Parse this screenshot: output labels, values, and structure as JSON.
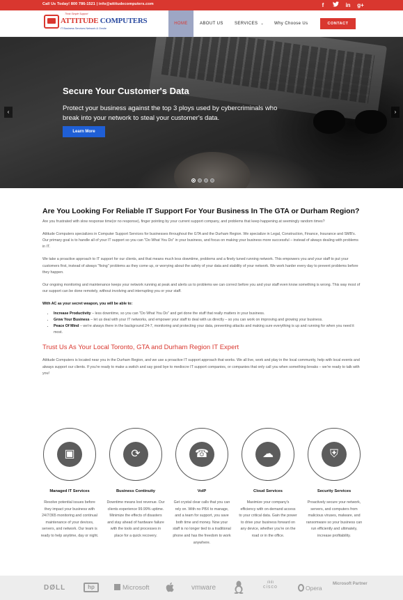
{
  "topbar": {
    "contact_text": "Call Us Today! 800 786-1521 | info@attitudecomputers.com",
    "socials": [
      "f",
      "t",
      "in",
      "g+"
    ],
    "social_icons": [
      "facebook-icon",
      "twitter-icon",
      "linkedin-icon",
      "google-plus-icon"
    ],
    "color": "#d9372f"
  },
  "header": {
    "logo_tagline_top": "Think Simple Support",
    "logo_name_1": "ATTITUDE",
    "logo_name_2": "COMPUTERS",
    "logo_sub": "IT Business Services Network & Onsite",
    "nav": [
      "HOME",
      "ABOUT US",
      "SERVICES",
      "Why Choose Us"
    ],
    "contact_label": "CONTACT"
  },
  "hero": {
    "title": "Secure Your Customer's Data",
    "body": "Protect your business against the top 3 ploys used by cybercriminals who break into your network to steal your customer's data.",
    "button": "Learn More",
    "prev": "‹",
    "next": "›",
    "slides": 4,
    "active_slide": 1
  },
  "intro": {
    "heading": "Are You Looking For Reliable IT Support For Your Business In The GTA or Durham Region?",
    "p1": "Are you frustrated with slow response time(or no response), finger pointing by your current support company, and problems that keep happening at seemingly random times?",
    "p2": "Attitude Computers specializes in Computer Support Services for businesses throughout the GTA and the Durham Region.  We specialize in Legal, Construction, Finance, Insurance and SMB's.  Our primary goal is to handle all of your IT support so you can \"Do What You Do\" in your business, and focus on making your business more successful – instead of always dealing with problems in IT.",
    "p3": "We take a proactive approach to IT support for our clients, and that means much less downtime, problems and a finely tuned running network. This empowers you and your staff to put your customers first, instead of always \"fixing\" problems as they come up, or worrying about the safety of your data and stability of your network. We work harder every day to prevent problems before they happen.",
    "p4": "Our ongoing monitoring and maintenance keeps your network running at peak and alerts us to problems we can correct before you and your staff even know something is wrong. This way most of our support can be done remotely, without involving and interrupting you or your staff.",
    "lead": "With AC as your secret weapon, you will be able to:",
    "bullets": [
      {
        "b": "Increase Productivity",
        "t": " – less downtime, so you can \"Do What You Do\" and get done the stuff that really matters in your business."
      },
      {
        "b": "Grow Your Business",
        "t": " – let us deal with your IT networks, and empower your staff to deal with us directly – so you can work on improving and growing your business."
      },
      {
        "b": "Peace Of Mind",
        "t": " – we're always there in the background 24-7, monitoring and protecting your data, preventing attacks and making sure everything is up and running for when you need it most."
      }
    ],
    "subheading": "Trust Us As Your Local Toronto, GTA and Durham Region IT Expert",
    "p5": "Attitude Computers is located near you in the Durham Region, and we use a proactive IT support approach that works. We all live, work and play in the local community, help with local events and always support our clients. If you're ready to make a switch and say good bye to mediocre IT support companies, or companies that only call you when something breaks – we're ready to talk with you!"
  },
  "services": [
    {
      "icon": "managed-it-icon",
      "glyph": "▣",
      "title": "Managed IT Services",
      "desc": "Resolve potential issues before they impact your business with 24/7/365 monitoring and continual maintenance of your devices, servers, and network. Our team is ready to help anytime, day or night."
    },
    {
      "icon": "business-continuity-icon",
      "glyph": "⟳",
      "title": "Business Continuity",
      "desc": "Downtime means lost revenue. Our clients experience 99.99% uptime. Minimize the effects of disasters and stay ahead of hardware failure with the tools and processes in place for a quick recovery."
    },
    {
      "icon": "voip-phone-icon",
      "glyph": "☎",
      "title": "VoIP",
      "desc": "Get crystal clear calls that you can rely on. With no PBX to manage, and a team for support, you save both time and money. Now your staff is no longer tied to a traditional phone and has the freedom to work anywhere."
    },
    {
      "icon": "cloud-services-icon",
      "glyph": "☁",
      "title": "Cloud Services",
      "desc": "Maximize your company's efficiency with on-demand access to your critical data. Gain the power to drive your business forward on any device, whether you're on the road or in the office."
    },
    {
      "icon": "security-services-icon",
      "glyph": "⛨",
      "title": "Security Services",
      "desc": "Proactively secure your network, servers, and computers from malicious viruses, malware, and ransomware so your business can run efficiently and ultimately, increase profitability."
    }
  ],
  "partners": [
    "DØLL",
    "hp",
    "Microsoft",
    "",
    "vmware",
    "",
    "cisco",
    "Opera",
    "Microsoft Partner"
  ],
  "partner_icons": [
    "dell-logo",
    "hp-logo",
    "microsoft-logo",
    "apple-logo",
    "vmware-logo",
    "linux-tux-logo",
    "cisco-logo",
    "opera-logo",
    "microsoft-partner-logo"
  ]
}
